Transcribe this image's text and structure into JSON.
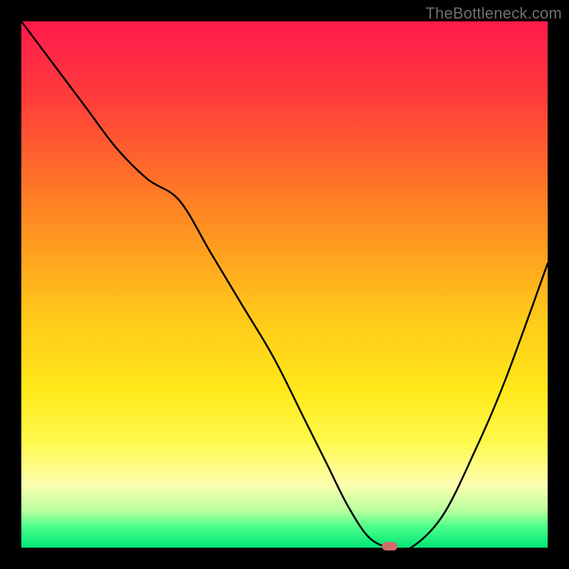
{
  "watermark": "TheBottleneck.com",
  "chart_data": {
    "type": "line",
    "title": "",
    "xlabel": "",
    "ylabel": "",
    "xlim": [
      0,
      100
    ],
    "ylim": [
      0,
      100
    ],
    "grid": false,
    "legend": false,
    "background_gradient": {
      "direction": "vertical",
      "stops": [
        {
          "pos": 0,
          "color": "#ff1a4d"
        },
        {
          "pos": 14,
          "color": "#ff3b3b"
        },
        {
          "pos": 28,
          "color": "#ff6a2a"
        },
        {
          "pos": 42,
          "color": "#ff9a1f"
        },
        {
          "pos": 56,
          "color": "#ffc81a"
        },
        {
          "pos": 70,
          "color": "#ffe81a"
        },
        {
          "pos": 80,
          "color": "#fff94d"
        },
        {
          "pos": 88,
          "color": "#fdffb0"
        },
        {
          "pos": 93,
          "color": "#b8ff9e"
        },
        {
          "pos": 96,
          "color": "#4cff8a"
        },
        {
          "pos": 100,
          "color": "#00e676"
        }
      ]
    },
    "series": [
      {
        "name": "bottleneck-curve",
        "color": "#000000",
        "x": [
          0,
          6,
          12,
          18,
          24,
          30,
          36,
          42,
          48,
          54,
          58,
          62,
          66,
          70,
          74,
          80,
          86,
          92,
          100
        ],
        "y": [
          100,
          92,
          84,
          76,
          70,
          66,
          56,
          46,
          36,
          24,
          16,
          8,
          2,
          0,
          0,
          6,
          18,
          32,
          54
        ]
      }
    ],
    "marker": {
      "name": "optimum-marker",
      "x": 70,
      "y": 0,
      "color": "#cf6a6a"
    }
  }
}
